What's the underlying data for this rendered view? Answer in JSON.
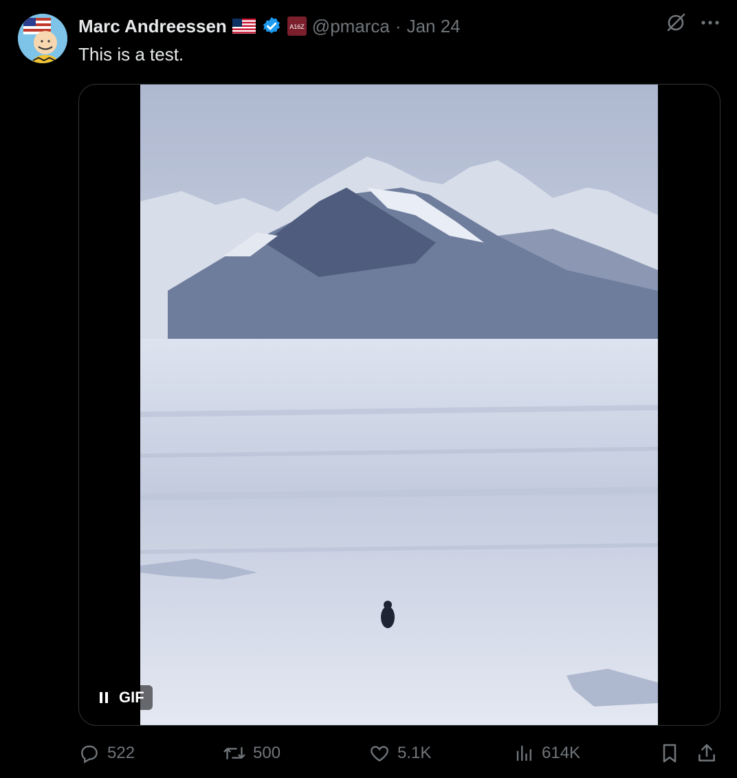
{
  "post": {
    "author_name": "Marc Andreessen",
    "handle": "@pmarca",
    "separator": "·",
    "date": "Jan 24",
    "text": "This is a test.",
    "affiliate_badge": "A16Z"
  },
  "media": {
    "badge_label": "GIF",
    "state": "playing"
  },
  "actions": {
    "replies": "522",
    "reposts": "500",
    "likes": "5.1K",
    "views": "614K"
  },
  "colors": {
    "background": "#000000",
    "text": "#e7e9ea",
    "muted": "#71767b",
    "verified": "#1d9bf0"
  },
  "icons": [
    "grok-icon",
    "more-icon",
    "reply-icon",
    "repost-icon",
    "like-icon",
    "views-icon",
    "bookmark-icon",
    "share-icon",
    "pause-icon",
    "verified-badge-icon",
    "us-flag-icon"
  ]
}
